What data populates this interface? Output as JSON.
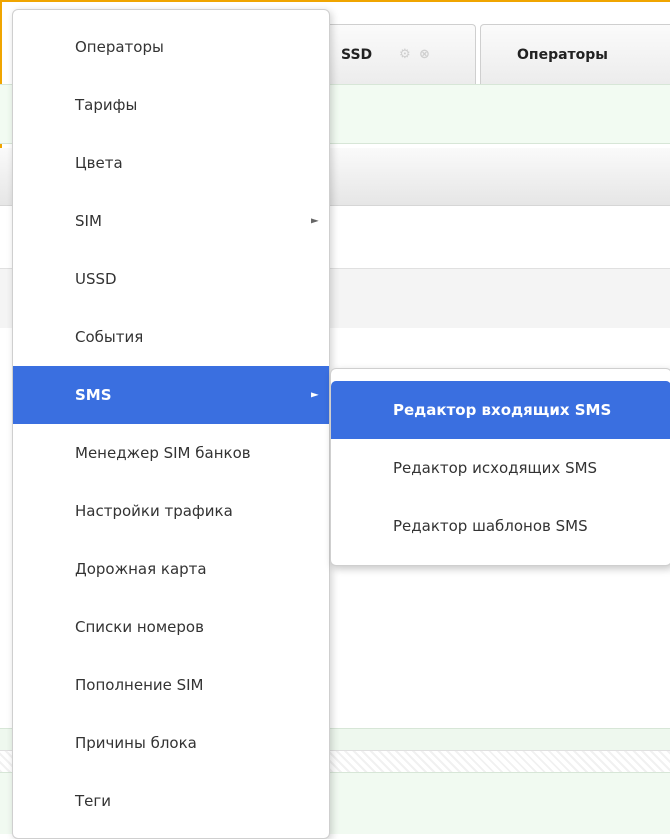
{
  "tabs": {
    "ussd_label": "SSD",
    "ussd_gear_icon": "gear-icon",
    "ussd_close_icon": "close-icon",
    "operators_label": "Операторы"
  },
  "menu": {
    "items": [
      {
        "label": "Операторы",
        "has_submenu": false
      },
      {
        "label": "Тарифы",
        "has_submenu": false
      },
      {
        "label": "Цвета",
        "has_submenu": false
      },
      {
        "label": "SIM",
        "has_submenu": true
      },
      {
        "label": "USSD",
        "has_submenu": false
      },
      {
        "label": "События",
        "has_submenu": false
      },
      {
        "label": "SMS",
        "has_submenu": true,
        "active": true
      },
      {
        "label": "Менеджер SIM банков",
        "has_submenu": false
      },
      {
        "label": "Настройки трафика",
        "has_submenu": false
      },
      {
        "label": "Дорожная карта",
        "has_submenu": false
      },
      {
        "label": "Списки номеров",
        "has_submenu": false
      },
      {
        "label": "Пополнение SIM",
        "has_submenu": false
      },
      {
        "label": "Причины блока",
        "has_submenu": false
      },
      {
        "label": "Теги",
        "has_submenu": false
      }
    ],
    "arrow_glyph": "►"
  },
  "submenu": {
    "items": [
      {
        "label": "Редактор входящих SMS",
        "active": true
      },
      {
        "label": "Редактор исходящих SMS"
      },
      {
        "label": "Редактор шаблонов SMS"
      }
    ]
  },
  "colors": {
    "accent": "#3a6fe0",
    "frame": "#f0a500"
  }
}
